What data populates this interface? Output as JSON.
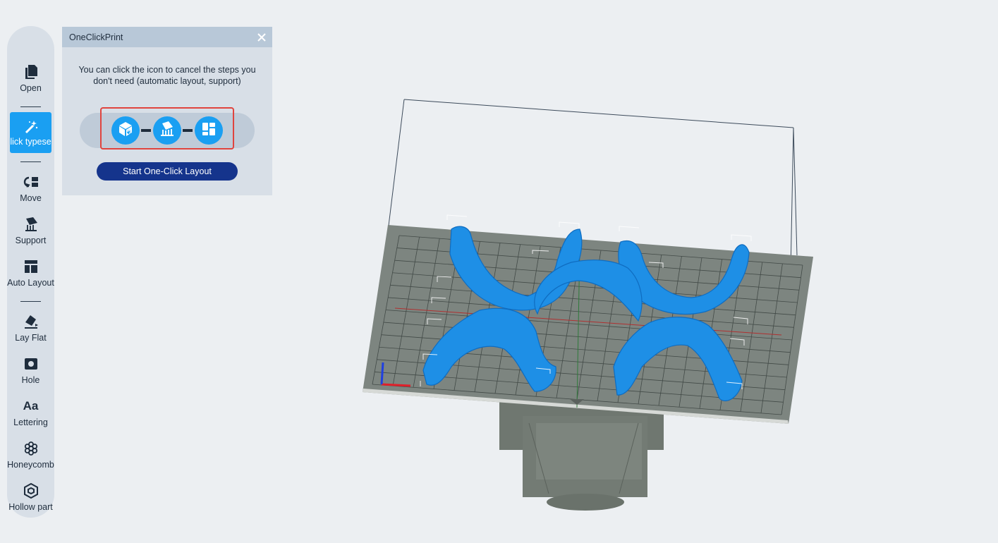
{
  "toolbar": {
    "items": [
      {
        "label": "Open",
        "icon": "file-icon"
      },
      {
        "label": "lick typese",
        "icon": "magic-wand-icon",
        "active": true
      },
      {
        "label": "Move",
        "icon": "move-icon"
      },
      {
        "label": "Support",
        "icon": "support-icon"
      },
      {
        "label": "Auto Layout",
        "icon": "layout-icon"
      },
      {
        "label": "Lay Flat",
        "icon": "lay-flat-icon"
      },
      {
        "label": "Hole",
        "icon": "hole-icon"
      },
      {
        "label": "Lettering",
        "icon": "lettering-icon"
      },
      {
        "label": "Honeycomb",
        "icon": "honeycomb-icon"
      },
      {
        "label": "Hollow part",
        "icon": "hollow-icon"
      }
    ],
    "lettering_glyph": "Aa"
  },
  "panel": {
    "title": "OneClickPrint",
    "description": "You can click the icon to cancel the steps you don't need (automatic layout, support)",
    "steps": [
      "orient-icon",
      "support-icon",
      "layout-icon"
    ],
    "start_button": "Start One-Click Layout"
  },
  "colors": {
    "accent": "#1a9ff2",
    "model": "#1e8fe6",
    "platform": "#7f8780",
    "button": "#15348c",
    "highlight": "#e0443e"
  }
}
